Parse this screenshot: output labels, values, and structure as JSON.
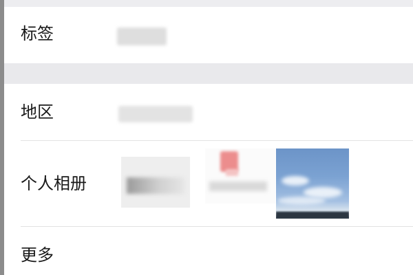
{
  "profile_rows": {
    "tags": {
      "label": "标签"
    },
    "region": {
      "label": "地区"
    },
    "album": {
      "label": "个人相册",
      "preview_text": ""
    },
    "more": {
      "label": "更多"
    }
  },
  "colors": {
    "background": "#e9e9ec",
    "row_background": "#ffffff",
    "label_text": "#1a1a1a",
    "divider": "#e2e2e2"
  }
}
